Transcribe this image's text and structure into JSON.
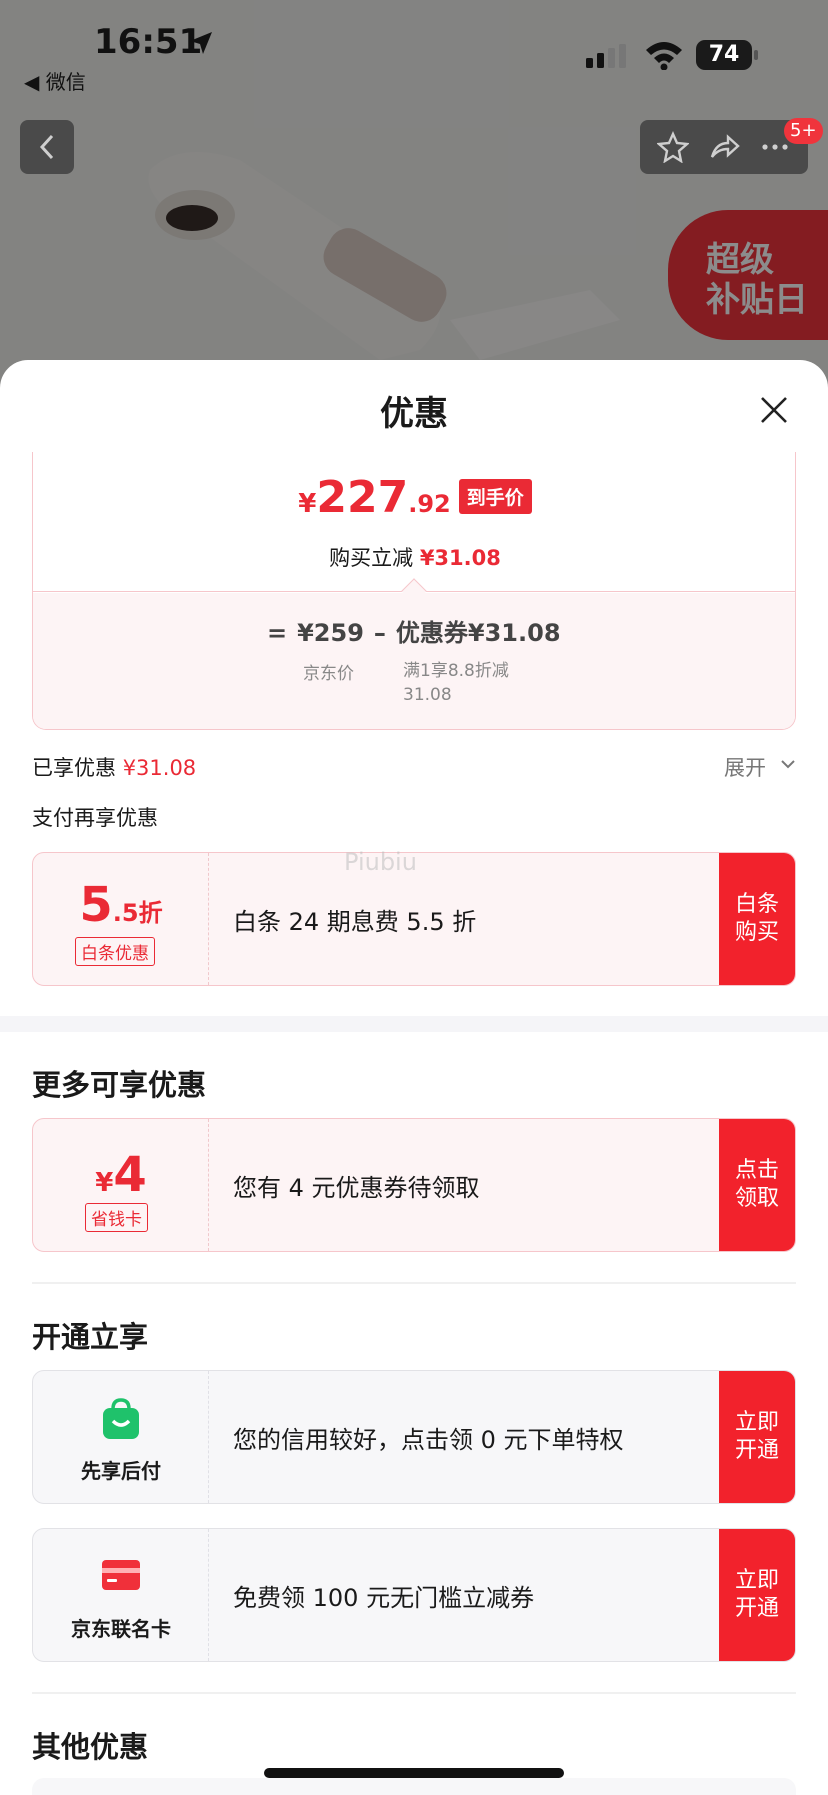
{
  "status_bar": {
    "time": "16:51",
    "back_app": "◀ 微信",
    "battery": "74"
  },
  "background": {
    "badge_line1": "超级",
    "badge_line2": "补贴日",
    "nav_badge": "5+"
  },
  "sheet": {
    "title": "优惠"
  },
  "price_card": {
    "yen": "¥",
    "price_int": "227",
    "price_dec": ".92",
    "price_tag": "到手价",
    "reduce_label": "购买立减",
    "reduce_amount": "¥31.08",
    "formula_eq": "=",
    "jd_price": "¥259",
    "minus": "–",
    "coupon": "优惠券¥31.08",
    "jd_price_label": "京东价",
    "coupon_desc": "满1享8.8折减31.08"
  },
  "enjoyed": {
    "label": "已享优惠",
    "amount": "¥31.08",
    "expand": "展开"
  },
  "pay_more_title": "支付再享优惠",
  "watermark": "Piubiu",
  "baitiao": {
    "num": "5",
    "rest": ".5折",
    "tag": "白条优惠",
    "text": "白条 24 期息费 5.5 折",
    "button": "白条购买"
  },
  "more_title": "更多可享优惠",
  "card_offer": {
    "yen": "¥",
    "num": "4",
    "tag": "省钱卡",
    "text": "您有 4 元优惠券待领取",
    "button": "点击领取"
  },
  "open_title": "开通立享",
  "credit_offer": {
    "label": "先享后付",
    "text": "您的信用较好，点击领 0 元下单特权",
    "button": "立即开通"
  },
  "card_member": {
    "label": "京东联名卡",
    "text": "免费领 100 元无门槛立减券",
    "button": "立即开通"
  },
  "other_title": "其他优惠",
  "colors": {
    "brand_red": "#ea2a35",
    "button_red": "#f2222c",
    "card_bg": "#fdf4f5",
    "green": "#1fc26b"
  }
}
